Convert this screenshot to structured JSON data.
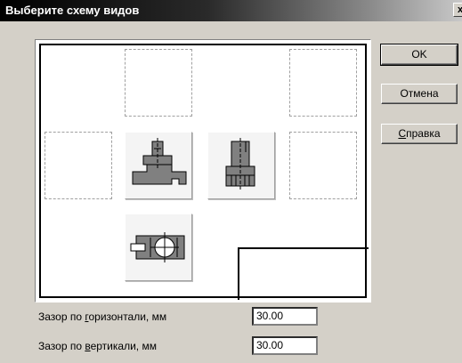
{
  "window": {
    "title": "Выберите схему видов",
    "close_glyph": "x"
  },
  "buttons": {
    "ok": "OK",
    "cancel": "Отмена",
    "help_prefix": "",
    "help_mnemonic": "С",
    "help_rest": "правка"
  },
  "views": {
    "slots": [
      "empty",
      "empty",
      "empty",
      "front-view",
      "side-view",
      "empty",
      "top-view"
    ]
  },
  "fields": {
    "horizontal": {
      "label_prefix": "Зазор по ",
      "label_mnemonic": "г",
      "label_rest": "оризонтали, мм",
      "value": "30.00"
    },
    "vertical": {
      "label_prefix": "Зазор по ",
      "label_mnemonic": "в",
      "label_rest": "ертикали, мм",
      "value": "30.00"
    }
  },
  "colors": {
    "part_fill": "#808080",
    "part_line": "#000000"
  }
}
